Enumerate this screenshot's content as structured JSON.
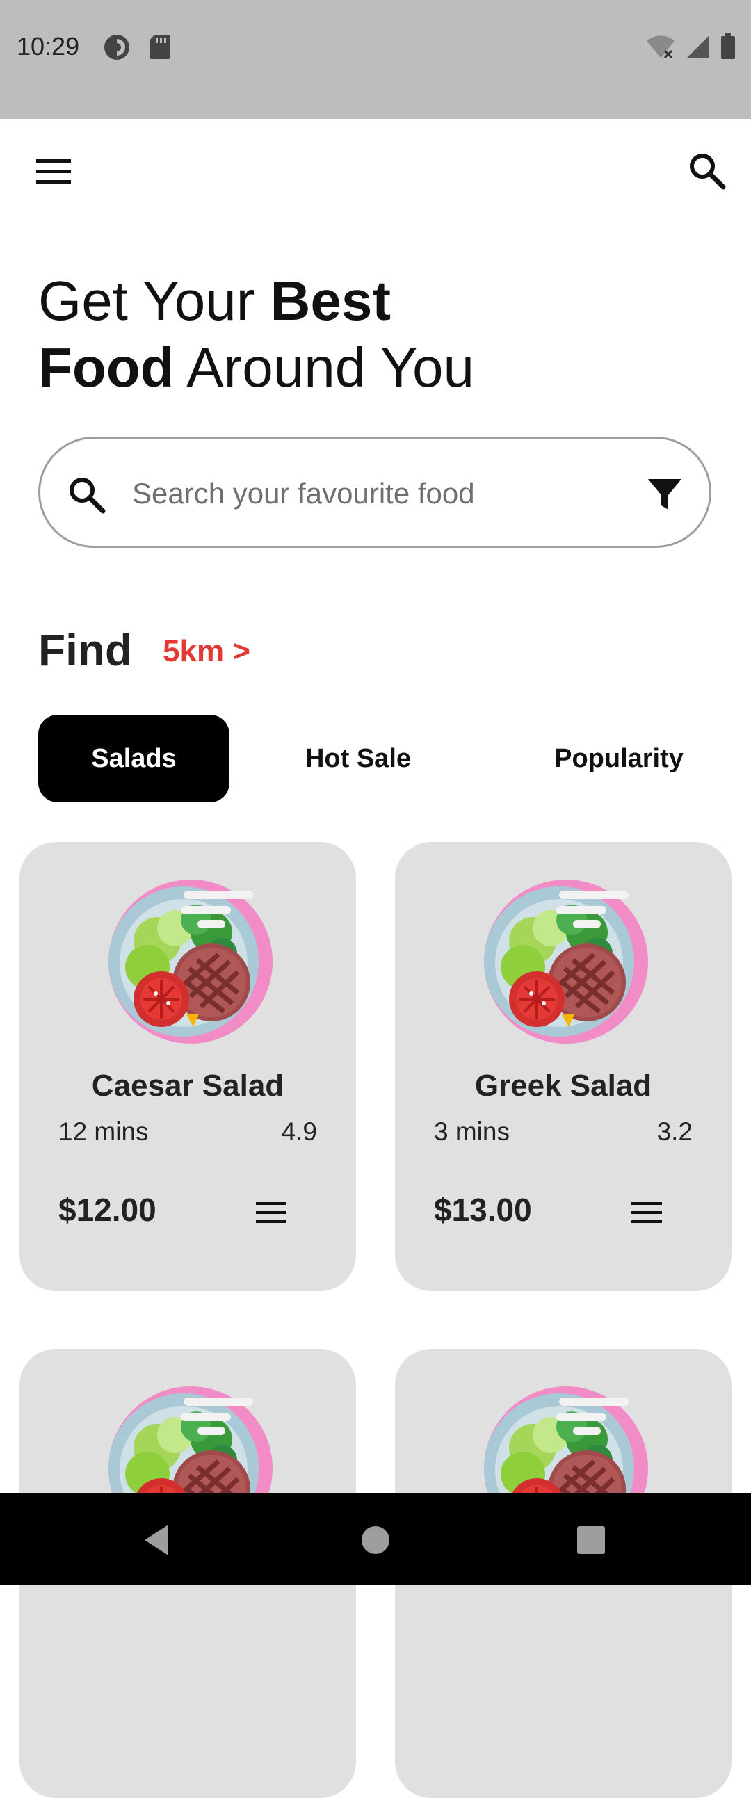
{
  "status_bar": {
    "time": "10:29",
    "left_icons": [
      "data-saver-icon",
      "sd-card-icon"
    ],
    "right_icons": [
      "wifi-off-icon",
      "cell-signal-icon",
      "battery-icon"
    ]
  },
  "app_bar": {
    "menu_icon": "menu-icon",
    "search_icon": "search-icon"
  },
  "headline": {
    "part1": "Get Your ",
    "part1_bold": "Best",
    "part2_bold": "Food",
    "part2": " Around You"
  },
  "search": {
    "placeholder": "Search your favourite food",
    "value": "",
    "filter_icon": "filter-icon"
  },
  "find": {
    "title": "Find",
    "distance_link": "5km >"
  },
  "tabs": [
    {
      "label": "Salads",
      "active": true
    },
    {
      "label": "Hot Sale",
      "active": false
    },
    {
      "label": "Popularity",
      "active": false
    }
  ],
  "cards": [
    {
      "name": "Caesar Salad",
      "time": "12 mins",
      "rating": "4.9",
      "price": "$12.00"
    },
    {
      "name": "Greek Salad",
      "time": "3 mins",
      "rating": "3.2",
      "price": "$13.00"
    },
    {
      "name": "",
      "time": "",
      "rating": "",
      "price": ""
    },
    {
      "name": "",
      "time": "",
      "rating": "",
      "price": ""
    }
  ],
  "nav_bar": {
    "buttons": [
      "back-icon",
      "home-icon",
      "recents-icon"
    ]
  },
  "colors": {
    "status_bar": "#bdbdbd",
    "accent_red": "#e53935",
    "card_bg": "#e0e0e0",
    "active_tab": "#000000"
  }
}
